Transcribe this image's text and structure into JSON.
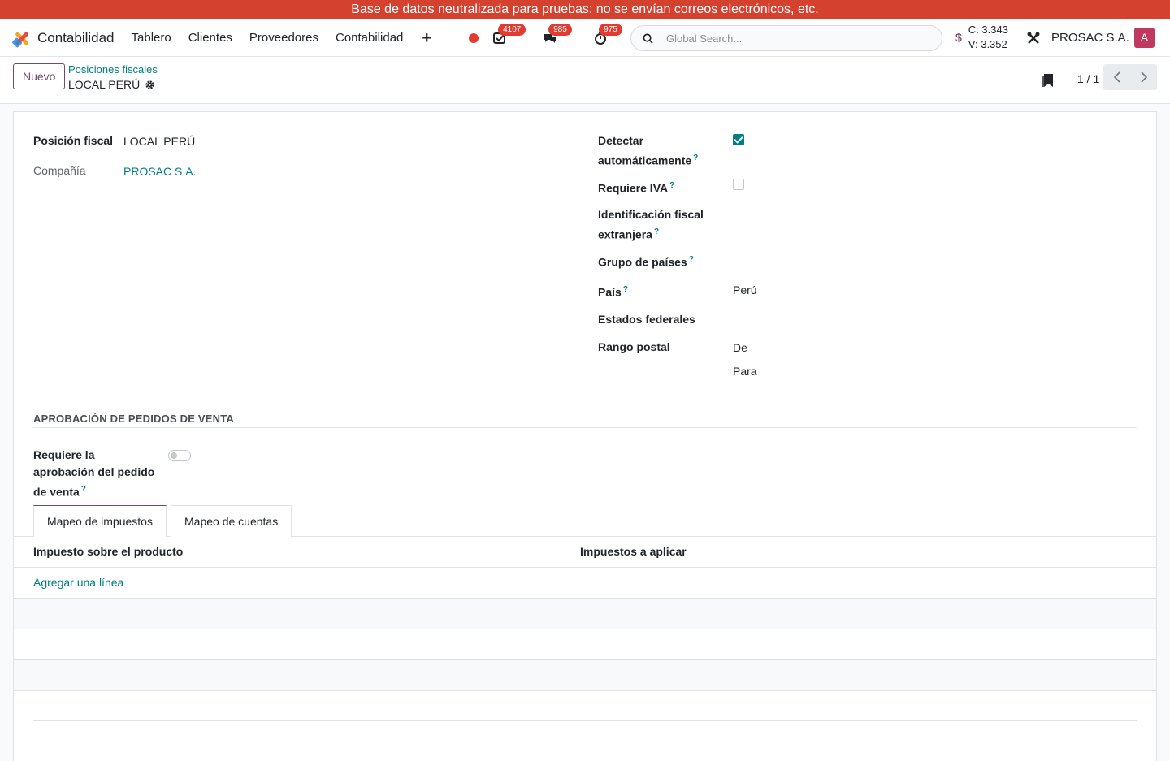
{
  "banner": {
    "text": "Base de datos neutralizada para pruebas: no se envían correos electrónicos, etc."
  },
  "navbar": {
    "app_name": "Contabilidad",
    "menu": [
      "Tablero",
      "Clientes",
      "Proveedores",
      "Contabilidad"
    ],
    "activities_count": "4107",
    "messages_count": "985",
    "timer_count": "975",
    "search_placeholder": "Global Search...",
    "currency_symbol": "$",
    "rate_c": "C: 3.343",
    "rate_v": "V: 3.352",
    "company": "PROSAC S.A.",
    "avatar_initial": "A",
    "colors": {
      "brand": "#714b67",
      "accent": "#017e84",
      "banner": "#d4422f",
      "badge": "#e03c31"
    }
  },
  "control": {
    "new_button": "Nuevo",
    "breadcrumb_parent": "Posiciones fiscales",
    "breadcrumb_current": "LOCAL PERÚ",
    "pager": "1 / 1"
  },
  "form": {
    "fiscal_position_label": "Posición fiscal",
    "fiscal_position_value": "LOCAL PERÚ",
    "company_label": "Compañía",
    "company_value": "PROSAC S.A.",
    "auto_detect_label_1": "Detectar",
    "auto_detect_label_2": "automáticamente",
    "auto_detect_checked": true,
    "vat_required_label": "Requiere IVA",
    "vat_required_checked": false,
    "foreign_vat_label_1": "Identificación fiscal",
    "foreign_vat_label_2": "extranjera",
    "country_group_label": "Grupo de países",
    "country_label": "País",
    "country_value": "Perú",
    "states_label": "Estados federales",
    "zip_range_label": "Rango postal",
    "zip_from": "De",
    "zip_to": "Para",
    "help_mark": "?",
    "section_title": "APROBACIÓN DE PEDIDOS DE VENTA",
    "so_approval_label_1": "Requiere la",
    "so_approval_label_2": "aprobación del pedido",
    "so_approval_label_3": "de venta",
    "so_approval_enabled": false
  },
  "tabs": [
    "Mapeo de impuestos",
    "Mapeo de cuentas"
  ],
  "table": {
    "columns": [
      "Impuesto sobre el producto",
      "Impuestos a aplicar"
    ],
    "add_line": "Agregar una línea"
  }
}
